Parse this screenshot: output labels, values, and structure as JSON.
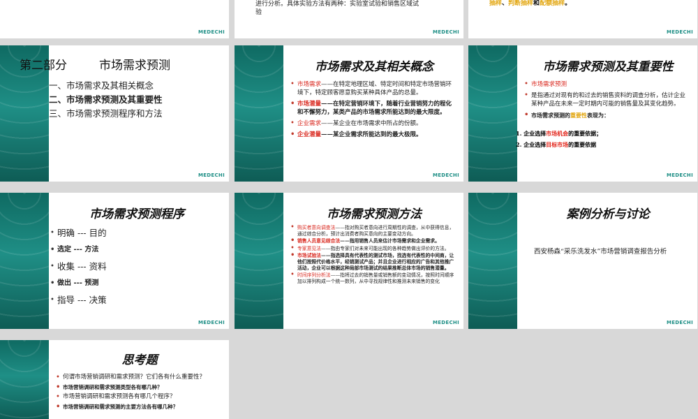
{
  "row0": {
    "middle_text": [
      "进行分析。具体实验方法有两种：实验室试验和销售区域试",
      "验"
    ],
    "right_parts": [
      "抽样",
      "、",
      "判断抽样",
      "和",
      "配额抽样",
      "。"
    ]
  },
  "logo": "MEDECHI",
  "s1": {
    "title_part": "第二部分",
    "title_text": "市场需求预测",
    "items": [
      "一、市场需求及其相关概念",
      "二、市场需求预测及其重要性",
      "三、市场需求预测程序和方法"
    ]
  },
  "s2": {
    "title": "市场需求及其相关概念",
    "items": [
      {
        "term": "市场需求",
        "text": "——在特定地理区域、特定时间和特定市场营销环境下，特定顾客愿意购买某种具体产品的总量。"
      },
      {
        "term": "市场潜量",
        "text": "——在特定营销环境下，随着行业营销努力的程化和不懈努力，某类产品的市场需求所能达到的最大限度。"
      },
      {
        "term": "企业需求",
        "text": "——某企业在市场需求中所占的份额。"
      },
      {
        "term": "企业潜量",
        "text": "——某企业需求所能达到的最大极限。"
      }
    ]
  },
  "s3": {
    "title": "市场需求预测及其重要性",
    "item1": "市场需求预测",
    "item2": "是指通过对现有的和过去的销售资料的调查分析，估计企业某种产品在未来一定时期内可能的销售量及其变化趋势。",
    "item3_a": "市场需求预测的",
    "item3_b": "重要性",
    "item3_c": "表现为：",
    "n1_num": "1.",
    "n1_a": "企业选择",
    "n1_b": "市场机会",
    "n1_c": "的重要依据；",
    "n2_num": "2.",
    "n2_a": "企业选择",
    "n2_b": "目标市场",
    "n2_c": "的重要依据"
  },
  "s4": {
    "title": "市场需求预测程序",
    "items": [
      "明确 --- 目的",
      "选定 --- 方法",
      "收集 --- 资料",
      "做出 --- 预测",
      "指导 --- 决策"
    ]
  },
  "s5": {
    "title": "市场需求预测方法",
    "items": [
      {
        "term": "购买者意向调查法",
        "text": "——指对购买者意向进行周期性的调查，从中获得信息，通过综合分析，预计出消费者购买意向的主要变动方向。"
      },
      {
        "term": "销售人员意见综合法",
        "text": "——指用销售人员来估计市场需求和企业需求。"
      },
      {
        "term": "专家意见法",
        "text": "——指由专家们对未来可能出现的各种趋势做出评价的方法。"
      },
      {
        "term": "市场试验法",
        "text": "——指选择具有代表性的测试市场，找选有代表性的中间商，让他们按照代价格水平，经销测试产品；并且企业进行相应的广告和其他推广活动，企业可以根据这种局部市场测试的结果推断总体市场的销售潜量。"
      },
      {
        "term": "时间序列分析法",
        "text": "——指将过去的销售量或销售额的变动情况，按照时间顺序加以排列构成一个统一数列，从中寻找规律性和推测未来销售的变化"
      }
    ]
  },
  "s6": {
    "title": "案例分析与讨论",
    "text": "西安杨森“采乐洗发水”市场营销调查报告分析"
  },
  "s7": {
    "title": "思考题",
    "items": [
      "何谓市场营销调研和需求预测？它们各有什么重要性？",
      "市场营销调研和需求预测类型各有哪几种？",
      "市场营销调研和需求预测各有哪几个程序？",
      "市场营销调研和需求预测的主要方法各有哪几种？"
    ]
  }
}
